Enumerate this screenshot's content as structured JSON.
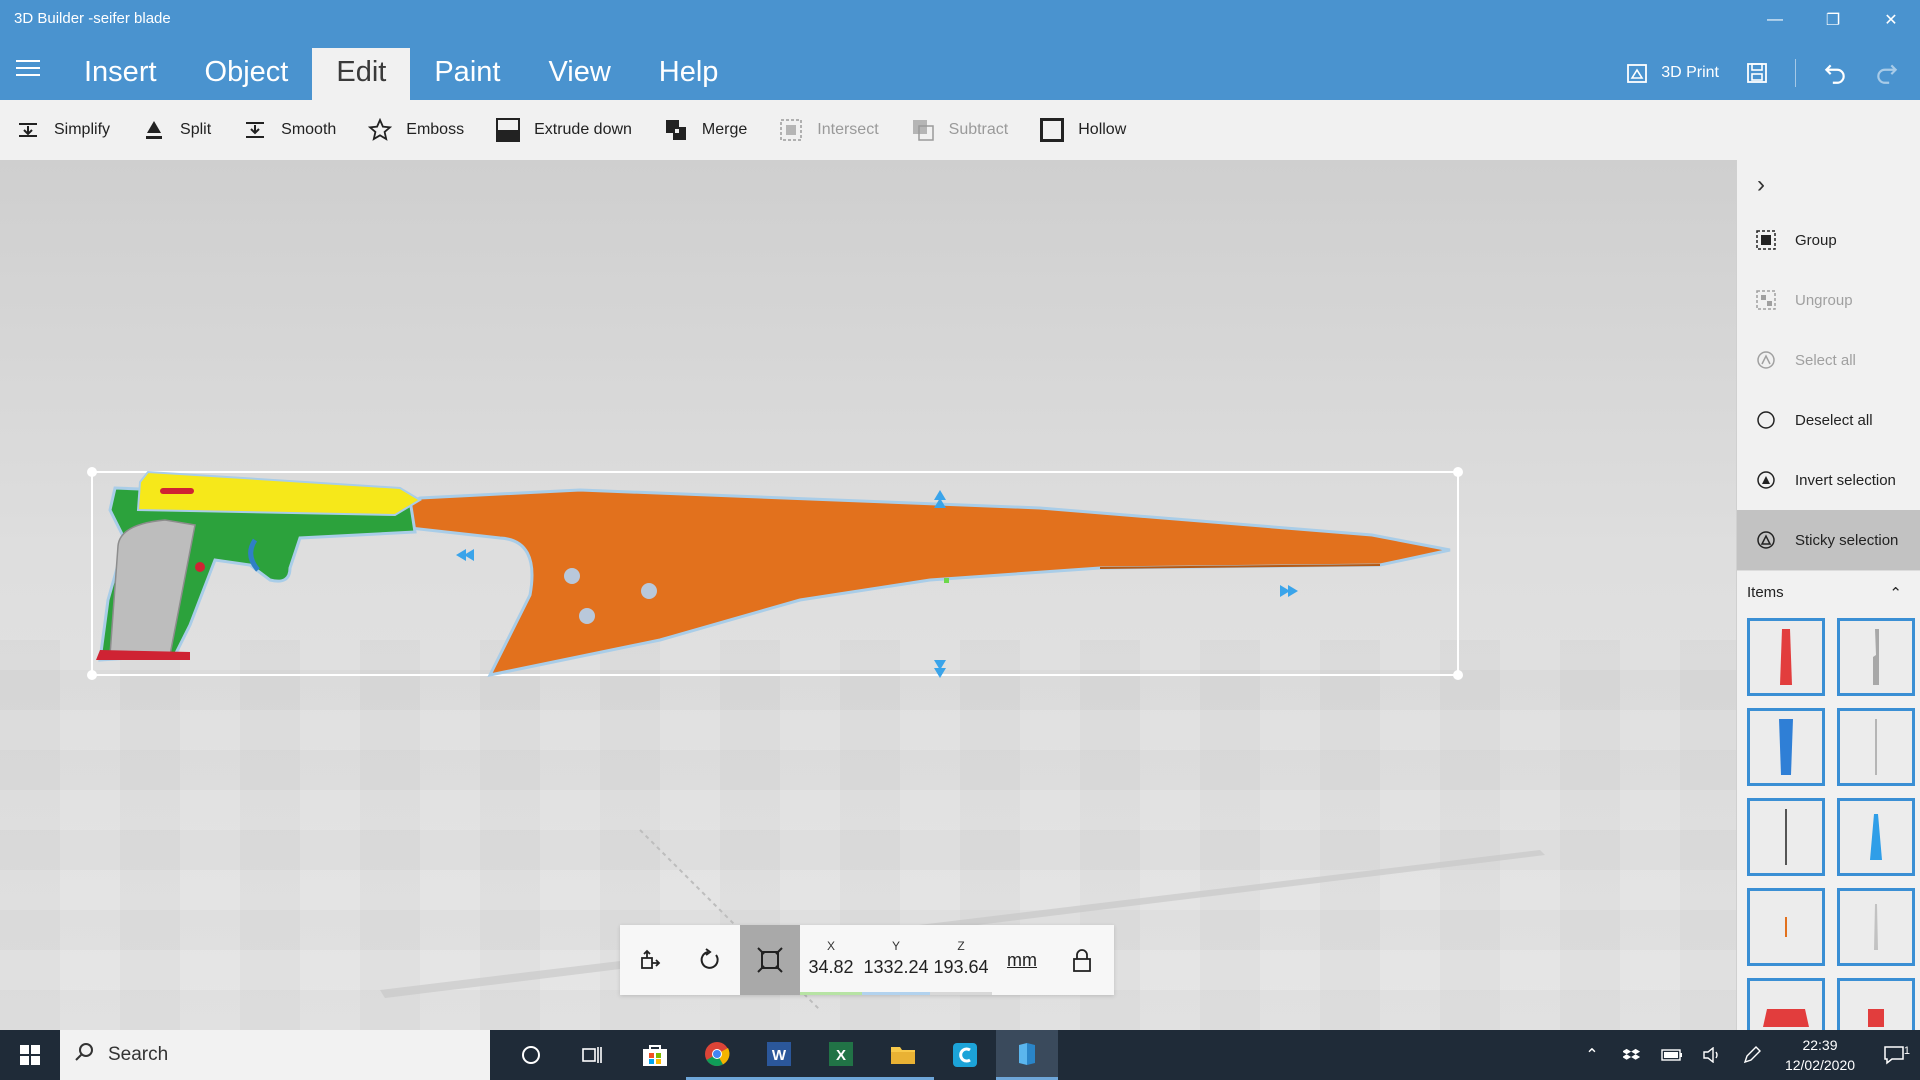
{
  "window": {
    "title": "3D Builder -seifer blade"
  },
  "tabs": [
    {
      "label": "Insert",
      "active": false
    },
    {
      "label": "Object",
      "active": false
    },
    {
      "label": "Edit",
      "active": true
    },
    {
      "label": "Paint",
      "active": false
    },
    {
      "label": "View",
      "active": false
    },
    {
      "label": "Help",
      "active": false
    }
  ],
  "header_actions": {
    "print_label": "3D Print"
  },
  "toolbar": [
    {
      "label": "Simplify",
      "icon": "simplify-icon",
      "enabled": true
    },
    {
      "label": "Split",
      "icon": "split-icon",
      "enabled": true
    },
    {
      "label": "Smooth",
      "icon": "smooth-icon",
      "enabled": true
    },
    {
      "label": "Emboss",
      "icon": "star-icon",
      "enabled": true
    },
    {
      "label": "Extrude down",
      "icon": "extrude-down-icon",
      "enabled": true
    },
    {
      "label": "Merge",
      "icon": "merge-icon",
      "enabled": true
    },
    {
      "label": "Intersect",
      "icon": "intersect-icon",
      "enabled": false
    },
    {
      "label": "Subtract",
      "icon": "subtract-icon",
      "enabled": false
    },
    {
      "label": "Hollow",
      "icon": "hollow-icon",
      "enabled": true
    }
  ],
  "panel": {
    "actions": [
      {
        "label": "Group",
        "enabled": true
      },
      {
        "label": "Ungroup",
        "enabled": false
      },
      {
        "label": "Select all",
        "enabled": false
      },
      {
        "label": "Deselect all",
        "enabled": true
      },
      {
        "label": "Invert selection",
        "enabled": true
      },
      {
        "label": "Sticky selection",
        "enabled": true,
        "active": true
      }
    ],
    "items_label": "Items"
  },
  "transform": {
    "x_label": "X",
    "x_value": "34.82",
    "y_label": "Y",
    "y_value": "1332.24",
    "z_label": "Z",
    "z_value": "193.64",
    "unit": "mm"
  },
  "taskbar": {
    "search_placeholder": "Search",
    "time": "22:39",
    "date": "12/02/2020",
    "notification_count": "1"
  },
  "colors": {
    "titlebar": "#4a93cf",
    "blade": "#e2711d",
    "gun_green": "#2ca23c",
    "gun_yellow": "#f6e81a",
    "selection_accent": "#3a8fd4"
  }
}
